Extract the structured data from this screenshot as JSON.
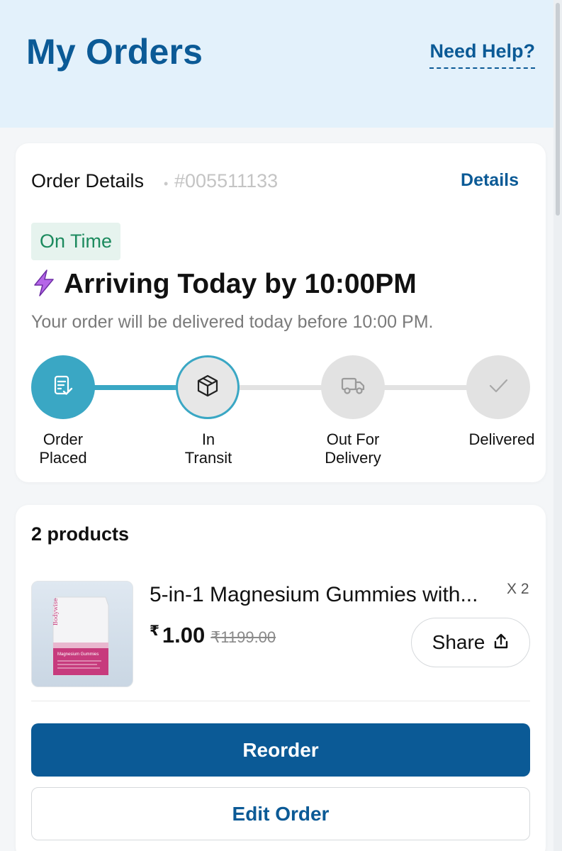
{
  "header": {
    "title": "My Orders",
    "help_link": "Need Help?"
  },
  "order": {
    "section_title": "Order Details",
    "separator": "•",
    "order_number": "#005511133",
    "details_link": "Details",
    "status_badge": "On Time",
    "arrival_icon": "lightning-icon",
    "arrival_text": "Arriving Today by 10:00PM",
    "arrival_subtext": "Your order will be delivered today before 10:00 PM.",
    "steps": [
      {
        "label": "Order Placed",
        "icon": "clipboard-check-icon",
        "state": "completed"
      },
      {
        "label": "In Transit",
        "icon": "box-icon",
        "state": "current"
      },
      {
        "label": "Out For Delivery",
        "icon": "truck-icon",
        "state": "pending"
      },
      {
        "label": "Delivered",
        "icon": "check-icon",
        "state": "pending"
      }
    ],
    "progress": 0.5
  },
  "products": {
    "count_label": "2 products",
    "items": [
      {
        "name": "5-in-1 Magnesium Gummies with...",
        "quantity": "X 2",
        "currency": "₹",
        "price": "1.00",
        "mrp": "₹1199.00",
        "image_text": "Magnesium Gummies",
        "brand": "Bodywise"
      }
    ],
    "share_label": "Share",
    "share_icon": "share-upload-icon",
    "reorder_label": "Reorder",
    "edit_label": "Edit Order"
  },
  "colors": {
    "brand": "#0b5a96",
    "header_bg": "#e3f1fb",
    "progress": "#3aa7c4",
    "on_time_bg": "#e6f3ee",
    "on_time_text": "#1c8a5e",
    "lightning": "#b566e8",
    "pending": "#e2e2e2"
  }
}
